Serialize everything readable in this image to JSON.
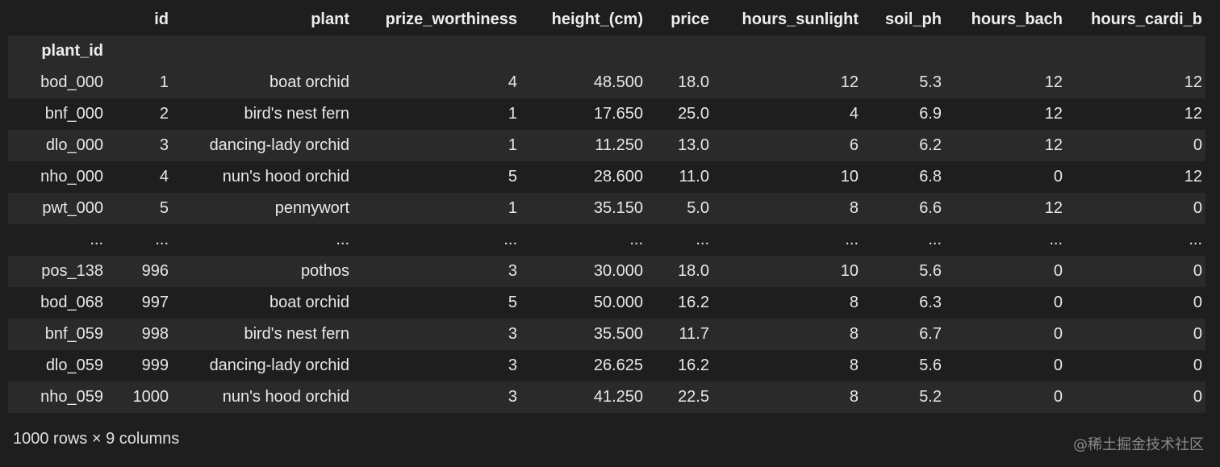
{
  "dataframe": {
    "index_name": "plant_id",
    "columns": [
      "id",
      "plant",
      "prize_worthiness",
      "height_(cm)",
      "price",
      "hours_sunlight",
      "soil_ph",
      "hours_bach",
      "hours_cardi_b"
    ],
    "rows": [
      {
        "index": "bod_000",
        "cells": [
          "1",
          "boat orchid",
          "4",
          "48.500",
          "18.0",
          "12",
          "5.3",
          "12",
          "12"
        ]
      },
      {
        "index": "bnf_000",
        "cells": [
          "2",
          "bird's nest fern",
          "1",
          "17.650",
          "25.0",
          "4",
          "6.9",
          "12",
          "12"
        ]
      },
      {
        "index": "dlo_000",
        "cells": [
          "3",
          "dancing-lady orchid",
          "1",
          "11.250",
          "13.0",
          "6",
          "6.2",
          "12",
          "0"
        ]
      },
      {
        "index": "nho_000",
        "cells": [
          "4",
          "nun's hood orchid",
          "5",
          "28.600",
          "11.0",
          "10",
          "6.8",
          "0",
          "12"
        ]
      },
      {
        "index": "pwt_000",
        "cells": [
          "5",
          "pennywort",
          "1",
          "35.150",
          "5.0",
          "8",
          "6.6",
          "12",
          "0"
        ]
      },
      {
        "index": "...",
        "cells": [
          "...",
          "...",
          "...",
          "...",
          "...",
          "...",
          "...",
          "...",
          "..."
        ]
      },
      {
        "index": "pos_138",
        "cells": [
          "996",
          "pothos",
          "3",
          "30.000",
          "18.0",
          "10",
          "5.6",
          "0",
          "0"
        ]
      },
      {
        "index": "bod_068",
        "cells": [
          "997",
          "boat orchid",
          "5",
          "50.000",
          "16.2",
          "8",
          "6.3",
          "0",
          "0"
        ]
      },
      {
        "index": "bnf_059",
        "cells": [
          "998",
          "bird's nest fern",
          "3",
          "35.500",
          "11.7",
          "8",
          "6.7",
          "0",
          "0"
        ]
      },
      {
        "index": "dlo_059",
        "cells": [
          "999",
          "dancing-lady orchid",
          "3",
          "26.625",
          "16.2",
          "8",
          "5.6",
          "0",
          "0"
        ]
      },
      {
        "index": "nho_059",
        "cells": [
          "1000",
          "nun's hood orchid",
          "3",
          "41.250",
          "22.5",
          "8",
          "5.2",
          "0",
          "0"
        ]
      }
    ],
    "shape_text": "1000 rows × 9 columns"
  },
  "watermark": "@稀土掘金技术社区",
  "colors": {
    "background": "#1e1e1e",
    "stripe": "#2a2a2a",
    "text": "#e8e8e8",
    "watermark": "#8a8a8a"
  }
}
